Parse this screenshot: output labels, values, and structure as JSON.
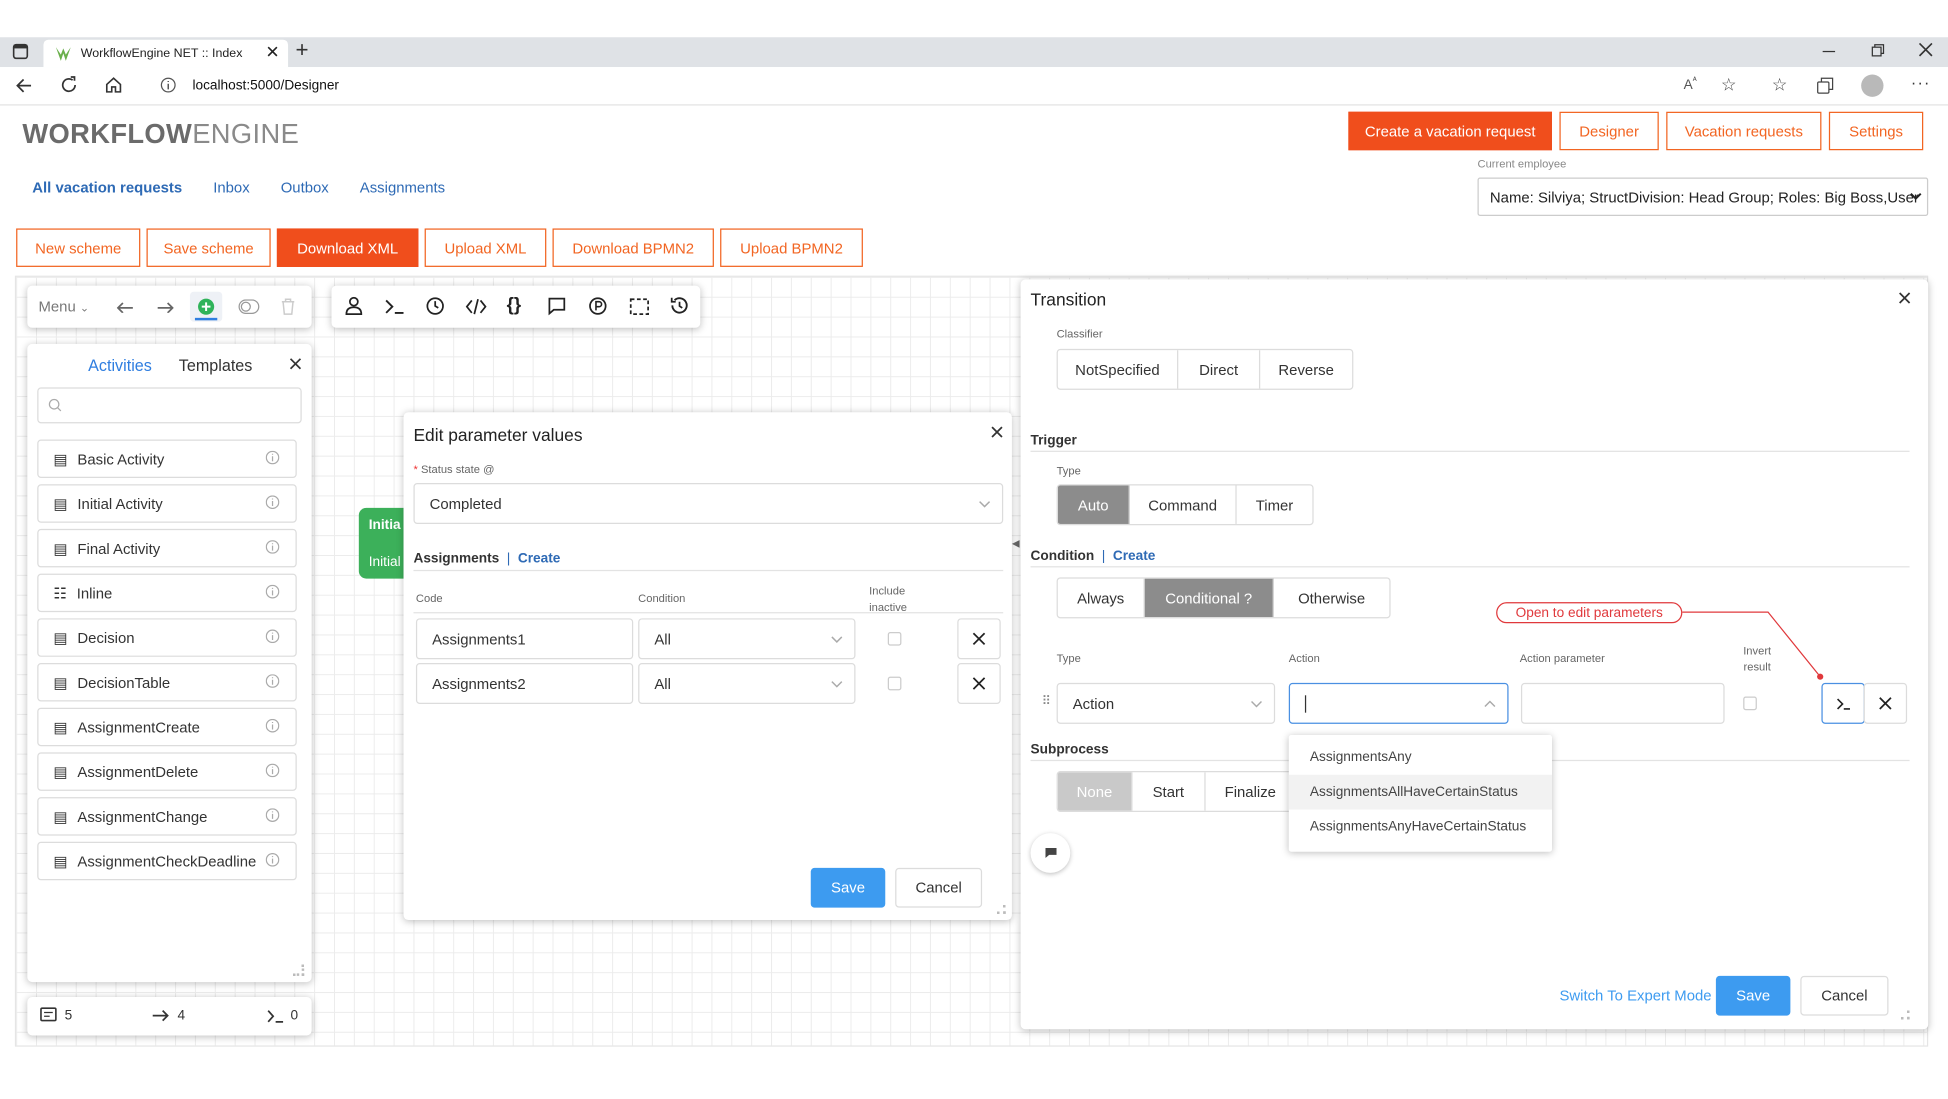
{
  "browser": {
    "tab_title": "WorkflowEngine NET :: Index",
    "new_tab": "+",
    "url": "localhost:5000/Designer"
  },
  "brand": {
    "bold": "WORKFLOW",
    "light": "ENGINE"
  },
  "header_buttons": {
    "create": "Create a vacation request",
    "designer": "Designer",
    "vacation": "Vacation requests",
    "settings": "Settings"
  },
  "subnav": {
    "all": "All vacation requests",
    "inbox": "Inbox",
    "outbox": "Outbox",
    "assignments": "Assignments"
  },
  "employee": {
    "label": "Current employee",
    "value": "Name: Silviya; StructDivision: Head Group; Roles: Big Boss,User"
  },
  "toolbar": {
    "new": "New scheme",
    "save": "Save scheme",
    "download_xml": "Download XML",
    "upload_xml": "Upload XML",
    "download_bpmn": "Download BPMN2",
    "upload_bpmn": "Upload BPMN2"
  },
  "designer_menu": {
    "label": "Menu"
  },
  "library": {
    "tab_activities": "Activities",
    "tab_templates": "Templates",
    "items": [
      "Basic Activity",
      "Initial Activity",
      "Final Activity",
      "Inline",
      "Decision",
      "DecisionTable",
      "AssignmentCreate",
      "AssignmentDelete",
      "AssignmentChange",
      "AssignmentCheckDeadline"
    ]
  },
  "stats": {
    "activities": "5",
    "transitions": "4",
    "commands": "0"
  },
  "canvas_node": {
    "title": "Initia",
    "subtitle": "Initial"
  },
  "param_dialog": {
    "title": "Edit parameter values",
    "required_mark": "*",
    "status_label": "Status state",
    "status_value": "Completed",
    "assignments_label": "Assignments",
    "separator": "|",
    "create_link": "Create",
    "col_code": "Code",
    "col_condition": "Condition",
    "col_include_1": "Include",
    "col_include_2": "inactive",
    "rows": [
      {
        "code": "Assignments1",
        "condition": "All"
      },
      {
        "code": "Assignments2",
        "condition": "All"
      }
    ],
    "save": "Save",
    "cancel": "Cancel"
  },
  "transition": {
    "title": "Transition",
    "classifier_label": "Classifier",
    "classifier": [
      "NotSpecified",
      "Direct",
      "Reverse"
    ],
    "trigger_label": "Trigger",
    "type_label": "Type",
    "trigger_types": [
      "Auto",
      "Command",
      "Timer"
    ],
    "condition_label": "Condition",
    "separator": "|",
    "create_link": "Create",
    "condition_types": [
      "Always",
      "Conditional ?",
      "Otherwise"
    ],
    "col_type": "Type",
    "col_action": "Action",
    "col_action_param": "Action parameter",
    "col_invert_1": "Invert",
    "col_invert_2": "result",
    "type_value": "Action",
    "callout": "Open to edit parameters",
    "subprocess_label": "Subprocess",
    "subprocess": [
      "None",
      "Start",
      "Finalize"
    ],
    "dropdown_options": [
      "AssignmentsAny",
      "AssignmentsAllHaveCertainStatus",
      "AssignmentsAnyHaveCertainStatus"
    ],
    "expert_mode": "Switch To Expert Mode",
    "save": "Save",
    "cancel": "Cancel"
  },
  "colors": {
    "brand_orange": "#f04e1c",
    "link_blue": "#2e6ab5",
    "save_blue": "#3d9bf0",
    "node_green": "#3cb05a"
  }
}
